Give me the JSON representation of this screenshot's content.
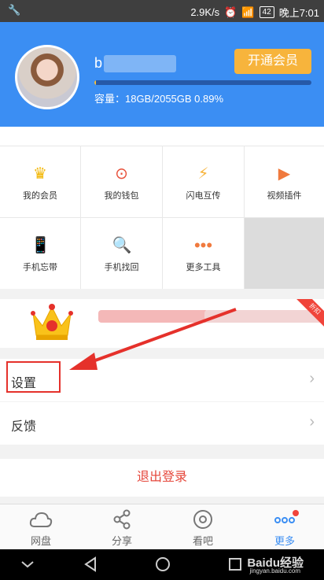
{
  "status": {
    "time": "晚上7:01",
    "speed": "2.9K/s",
    "battery": "42"
  },
  "profile": {
    "username": "b",
    "vip_button": "开通会员",
    "capacity": "容量：18GB/2055GB 0.89%",
    "progress_pct": 0.89
  },
  "tools": [
    {
      "label": "我的会员",
      "icon": "crown-icon"
    },
    {
      "label": "我的钱包",
      "icon": "wallet-icon"
    },
    {
      "label": "闪电互传",
      "icon": "lightning-icon"
    },
    {
      "label": "视频插件",
      "icon": "video-icon"
    },
    {
      "label": "手机忘带",
      "icon": "phone-lock-icon"
    },
    {
      "label": "手机找回",
      "icon": "phone-search-icon"
    },
    {
      "label": "更多工具",
      "icon": "more-dots-icon"
    }
  ],
  "banner": {
    "corner_badge": "折扣"
  },
  "menu": {
    "settings": "设置",
    "feedback": "反馈"
  },
  "logout_label": "退出登录",
  "tabs": [
    {
      "label": "网盘",
      "icon": "cloud-icon"
    },
    {
      "label": "分享",
      "icon": "share-icon"
    },
    {
      "label": "看吧",
      "icon": "eye-icon"
    },
    {
      "label": "更多",
      "icon": "more-icon"
    }
  ],
  "watermark": {
    "text": "Baidu经验",
    "url": "jingyan.baidu.com"
  },
  "colors": {
    "brand": "#3b8ef3",
    "vip": "#f7b43c",
    "danger": "#e5463a"
  }
}
